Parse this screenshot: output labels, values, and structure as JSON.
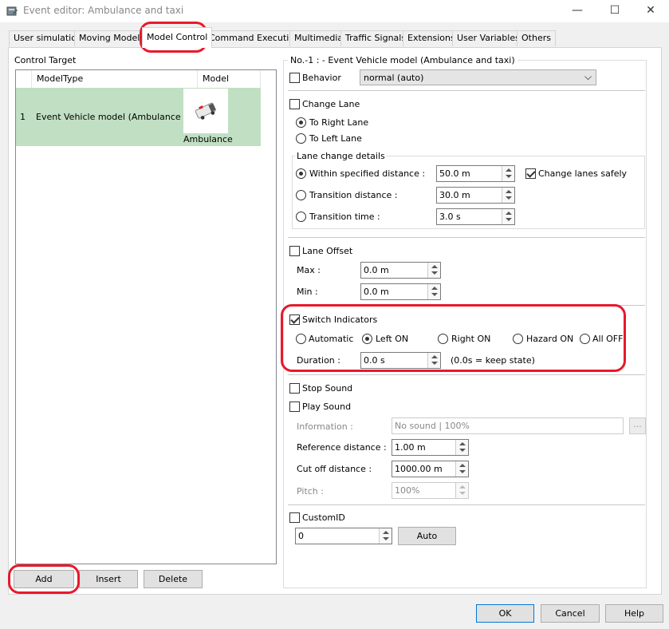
{
  "window": {
    "title": "Event editor: Ambulance and taxi",
    "controls": {
      "minimize": "—",
      "maximize": "☐",
      "close": "✕"
    }
  },
  "tabs": [
    {
      "label": "User simulation",
      "active": false
    },
    {
      "label": "Moving Models",
      "active": false
    },
    {
      "label": "Model Control",
      "active": true
    },
    {
      "label": "Command Execution",
      "active": false
    },
    {
      "label": "Multimedia",
      "active": false
    },
    {
      "label": "Traffic Signals",
      "active": false
    },
    {
      "label": "Extensions",
      "active": false
    },
    {
      "label": "User Variables",
      "active": false
    },
    {
      "label": "Others",
      "active": false
    }
  ],
  "control_target": {
    "label": "Control Target",
    "columns": [
      "ModelType",
      "Model"
    ],
    "rows": [
      {
        "index": "1",
        "model_type": "Event Vehicle model (Ambulance a...",
        "model": "Ambulance"
      }
    ],
    "buttons": {
      "add": "Add",
      "insert": "Insert",
      "delete": "Delete"
    }
  },
  "details": {
    "header": "No.-1 : - Event Vehicle model (Ambulance and taxi)",
    "behavior": {
      "label": "Behavior",
      "checked": false,
      "value": "normal (auto)"
    },
    "change_lane": {
      "label": "Change Lane",
      "checked": false,
      "to_right": "To Right Lane",
      "to_left": "To Left Lane",
      "details_label": "Lane change details",
      "within_distance": {
        "label": "Within specified distance :",
        "value": "50.0 m"
      },
      "change_safely": "Change lanes safely",
      "transition_distance": {
        "label": "Transition distance :",
        "value": "30.0 m"
      },
      "transition_time": {
        "label": "Transition time :",
        "value": "3.0 s"
      }
    },
    "lane_offset": {
      "label": "Lane Offset",
      "checked": false,
      "max": {
        "label": "Max :",
        "value": "0.0 m"
      },
      "min": {
        "label": "Min :",
        "value": "0.0 m"
      }
    },
    "switch_indicators": {
      "label": "Switch Indicators",
      "checked": true,
      "options": [
        "Automatic",
        "Left ON",
        "Right ON",
        "Hazard ON",
        "All OFF"
      ],
      "selected": "Left ON",
      "duration": {
        "label": "Duration :",
        "value": "0.0 s",
        "hint": "(0.0s = keep state)"
      }
    },
    "stop_sound": {
      "label": "Stop Sound",
      "checked": false
    },
    "play_sound": {
      "label": "Play Sound",
      "checked": false,
      "information": {
        "label": "Information :",
        "value": "No sound | 100%",
        "browse": "..."
      },
      "reference_distance": {
        "label": "Reference distance :",
        "value": "1.00 m"
      },
      "cut_off_distance": {
        "label": "Cut off distance :",
        "value": "1000.00 m"
      },
      "pitch": {
        "label": "Pitch :",
        "value": "100%"
      }
    },
    "custom_id": {
      "label": "CustomID",
      "checked": false,
      "value": "0",
      "auto": "Auto"
    }
  },
  "footer": {
    "ok": "OK",
    "cancel": "Cancel",
    "help": "Help"
  },
  "colors": {
    "selected_row": "#c1dfc3",
    "highlight_ring": "#e8192c",
    "default_button_border": "#0078d7"
  }
}
